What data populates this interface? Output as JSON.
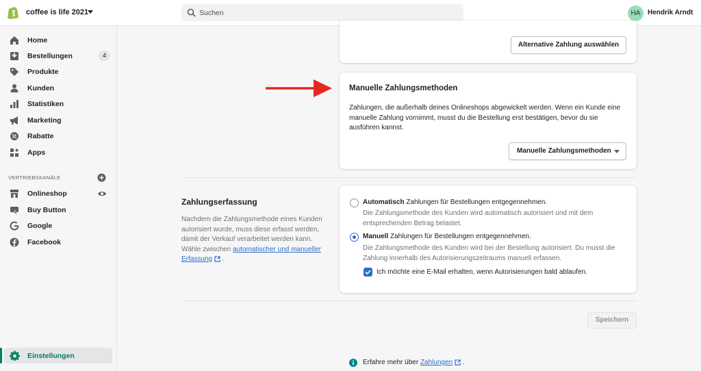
{
  "app": {
    "store_name": "coffee is life 2021",
    "accent": "#008060",
    "link_color": "#2c6ecb"
  },
  "search": {
    "placeholder": "Suchen"
  },
  "user": {
    "initials": "HA",
    "name": "Hendrik Arndt"
  },
  "sidebar": {
    "items": [
      {
        "label": "Home",
        "icon": "home-icon"
      },
      {
        "label": "Bestellungen",
        "icon": "orders-icon",
        "badge": "4"
      },
      {
        "label": "Produkte",
        "icon": "tag-icon"
      },
      {
        "label": "Kunden",
        "icon": "person-icon"
      },
      {
        "label": "Statistiken",
        "icon": "analytics-icon"
      },
      {
        "label": "Marketing",
        "icon": "megaphone-icon"
      },
      {
        "label": "Rabatte",
        "icon": "discount-icon"
      },
      {
        "label": "Apps",
        "icon": "apps-icon"
      }
    ],
    "channels_title": "VERTRIEBSKANÄLE",
    "channels": [
      {
        "label": "Onlineshop",
        "icon": "store-icon"
      },
      {
        "label": "Buy Button",
        "icon": "buy-button-icon"
      },
      {
        "label": "Google",
        "icon": "google-icon"
      },
      {
        "label": "Facebook",
        "icon": "facebook-icon"
      }
    ],
    "settings_label": "Einstellungen"
  },
  "main": {
    "alt_payment_button": "Alternative Zahlung auswählen",
    "manual_card": {
      "title": "Manuelle Zahlungsmethoden",
      "description": "Zahlungen, die außerhalb deines Onlineshops abgewickelt werden. Wenn ein Kunde eine manuelle Zahlung vornimmt, musst du die Bestellung erst bestätigen, bevor du sie ausführen kannst.",
      "dropdown_label": "Manuelle Zahlungsmethoden"
    },
    "capture": {
      "heading": "Zahlungserfassung",
      "description": "Nachdem die Zahlungsmethode eines Kunden autorisiert wurde, muss diese erfasst werden, damit der Verkauf verarbeitet werden kann. Wähle zwischen",
      "link": "automatischer und manueller Erfassung",
      "link_suffix": " .",
      "option_auto_bold": "Automatisch",
      "option_auto_rest": " Zahlungen für Bestellungen entgegennehmen.",
      "option_auto_help": "Die Zahlungsmethode des Kunden wird automatisch autorisiert und mit dem entsprechenden Betrag belastet.",
      "option_manual_bold": "Manuell",
      "option_manual_rest": " Zahlungen für Bestellungen entgegennehmen.",
      "option_manual_help": "Die Zahlungsmethode des Kunden wird bei der Bestellung autorisiert. Du musst die Zahlung innerhalb des Autorisierungszeitraums manuell erfassen.",
      "selected": "Manuell",
      "checkbox_label": "Ich möchte eine E-Mail erhalten, wenn Autorisierungen bald ablaufen.",
      "checkbox_checked": true
    },
    "save_button": "Speichern",
    "footer_prefix": "Erfahre mehr über ",
    "footer_link": "Zahlungen",
    "footer_suffix": " ."
  }
}
